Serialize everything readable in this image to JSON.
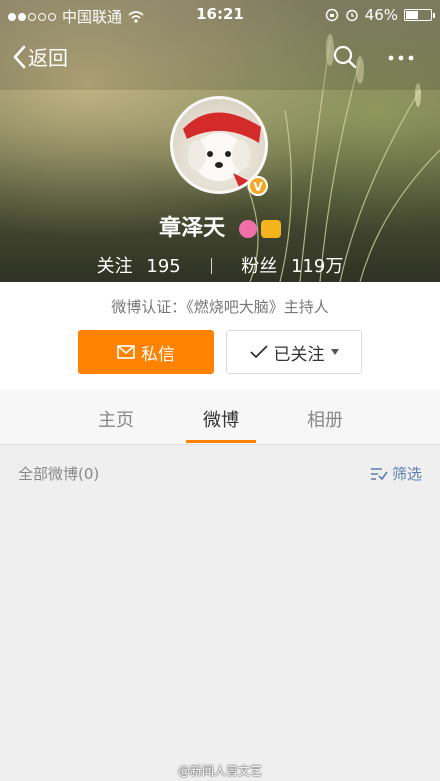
{
  "status_bar": {
    "carrier": "中国联通",
    "time": "16:21",
    "battery": "46%",
    "battery_level": 0.46
  },
  "nav": {
    "back_label": "返回"
  },
  "profile": {
    "name": "章泽天",
    "following_label": "关注",
    "following_count": "195",
    "followers_label": "粉丝",
    "followers_count": "119万",
    "verified_badge": "V",
    "verification_text": "微博认证：《燃烧吧大脑》主持人"
  },
  "actions": {
    "message_label": "私信",
    "following_button_label": "已关注"
  },
  "tabs": [
    {
      "label": "主页"
    },
    {
      "label": "微博",
      "active": true
    },
    {
      "label": "相册"
    }
  ],
  "feed": {
    "all_posts_label": "全部微博(0)",
    "filter_label": "筛选"
  },
  "watermark": "@新闻人曾文艺",
  "colors": {
    "accent": "#ff8200",
    "link": "#5d7fb0"
  }
}
